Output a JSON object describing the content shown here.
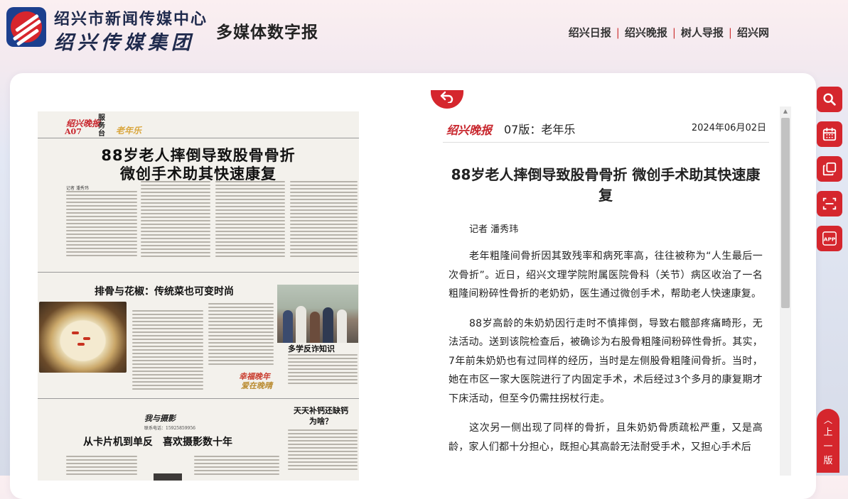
{
  "header": {
    "org_name_top": "绍兴市新闻传媒中心",
    "org_name_bottom": "绍兴传媒集团",
    "site_title": "多媒体数字报",
    "nav": [
      "绍兴日报",
      "绍兴晚报",
      "树人导报",
      "绍兴网"
    ]
  },
  "newspaper": {
    "brand": "绍兴晚报",
    "page_no": "A07",
    "column": "服务台",
    "section_tag": "老年乐",
    "headline_line1": "88岁老人摔倒导致股骨骨折",
    "headline_line2": "微创手术助其快速康复",
    "byline1": "记者 潘秀玮",
    "sub_headline_recipe": "排骨与花椒：传统菜也可变时尚",
    "sub_headline_fraud": "多学反诈知识",
    "sub_headline_calcium_1": "天天补钙还缺钙",
    "sub_headline_calcium_2": "为啥？",
    "sub_headline_photo": "从卡片机到单反　喜欢摄影数十年",
    "hotline": "联系电话：15925859956"
  },
  "article": {
    "back_label": "返回",
    "brand": "绍兴晚报",
    "edition": "07版：老年乐",
    "date": "2024年06月02日",
    "title": "88岁老人摔倒导致股骨骨折 微创手术助其快速康复",
    "author": "记者 潘秀玮",
    "paragraphs": [
      "老年粗隆间骨折因其致残率和病死率高，往往被称为“人生最后一次骨折”。近日，绍兴文理学院附属医院骨科（关节）病区收治了一名粗隆间粉碎性骨折的老奶奶，医生通过微创手术，帮助老人快速康复。",
      "88岁高龄的朱奶奶因行走时不慎摔倒，导致右髋部疼痛畸形，无法活动。送到该院检查后，被确诊为右股骨粗隆间粉碎性骨折。其实，7年前朱奶奶也有过同样的经历，当时是左侧股骨粗隆间骨折。当时，她在市区一家大医院进行了内固定手术，术后经过3个多月的康复期才下床活动，但至今仍需拄拐杖行走。",
      "这次另一侧出现了同样的骨折，且朱奶奶骨质疏松严重，又是高龄，家人们都十分担心，既担心其高龄无法耐受手术，又担心手术后"
    ]
  },
  "toolbar": {
    "tools": [
      "search-icon",
      "calendar-icon",
      "copy-icon",
      "scan-icon",
      "app-icon"
    ],
    "app_label": "APP",
    "upper_label": "上一版"
  },
  "colors": {
    "accent": "#d5262d",
    "brand_blue": "#1c3f8e",
    "text": "#222222"
  }
}
